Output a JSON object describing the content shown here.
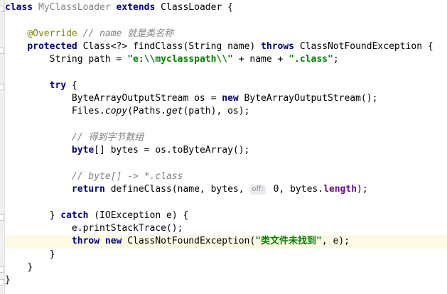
{
  "code": {
    "l1": {
      "kw1": "class",
      "name": "MyClassLoader",
      "kw2": "extends",
      "parent": "ClassLoader {"
    },
    "l3": {
      "ann": "@Override",
      "comment": "// name 就是类名称"
    },
    "l4": {
      "kw1": "protected",
      "t1": " Class<?> findClass(String name) ",
      "kw2": "throws",
      "t2": " ClassNotFoundException {"
    },
    "l5": {
      "t1": "String path = ",
      "s1": "\"e:\\\\myclasspath\\\\\"",
      "t2": " + name + ",
      "s2": "\".class\"",
      "t3": ";"
    },
    "l7": {
      "kw": "try",
      "t": " {"
    },
    "l8": {
      "t1": "ByteArrayOutputStream os = ",
      "kw": "new",
      "t2": " ByteArrayOutputStream();"
    },
    "l9": {
      "t1": "Files.",
      "m1": "copy",
      "t2": "(Paths.",
      "m2": "get",
      "t3": "(path), os);"
    },
    "l11": {
      "comment": "// 得到字节数组"
    },
    "l12": {
      "kw": "byte",
      "t": "[] bytes = os.toByteArray();"
    },
    "l14": {
      "comment": "// byte[] -> *.class"
    },
    "l15": {
      "kw": "return",
      "t1": " defineClass(name, bytes, ",
      "hint": "off:",
      "t2": " 0, bytes.",
      "fld": "length",
      "t3": ");"
    },
    "l17": {
      "t1": "} ",
      "kw": "catch",
      "t2": " (IOException e) {"
    },
    "l18": {
      "t": "e.printStackTrace();"
    },
    "l19": {
      "kw1": "throw",
      "kw2": "new",
      "t1": " ClassNotFoundException(",
      "s": "\"类文件未找到\"",
      "t2": ", e);"
    },
    "l20": {
      "t": "}"
    },
    "l21": {
      "t": "}"
    },
    "l22": {
      "t": "}"
    }
  }
}
